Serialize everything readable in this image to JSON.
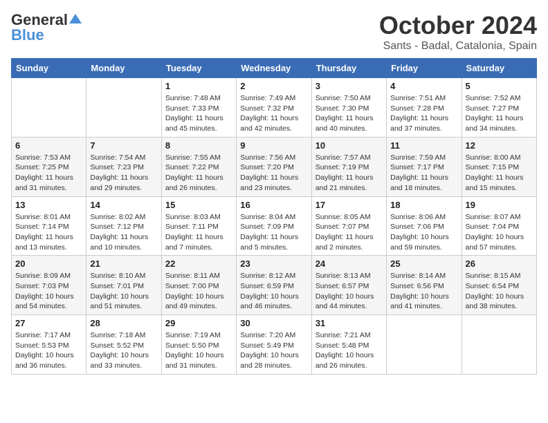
{
  "logo": {
    "general": "General",
    "blue": "Blue"
  },
  "title": "October 2024",
  "location": "Sants - Badal, Catalonia, Spain",
  "days_of_week": [
    "Sunday",
    "Monday",
    "Tuesday",
    "Wednesday",
    "Thursday",
    "Friday",
    "Saturday"
  ],
  "weeks": [
    [
      {
        "day": "",
        "sunrise": "",
        "sunset": "",
        "daylight": ""
      },
      {
        "day": "",
        "sunrise": "",
        "sunset": "",
        "daylight": ""
      },
      {
        "day": "1",
        "sunrise": "Sunrise: 7:48 AM",
        "sunset": "Sunset: 7:33 PM",
        "daylight": "Daylight: 11 hours and 45 minutes."
      },
      {
        "day": "2",
        "sunrise": "Sunrise: 7:49 AM",
        "sunset": "Sunset: 7:32 PM",
        "daylight": "Daylight: 11 hours and 42 minutes."
      },
      {
        "day": "3",
        "sunrise": "Sunrise: 7:50 AM",
        "sunset": "Sunset: 7:30 PM",
        "daylight": "Daylight: 11 hours and 40 minutes."
      },
      {
        "day": "4",
        "sunrise": "Sunrise: 7:51 AM",
        "sunset": "Sunset: 7:28 PM",
        "daylight": "Daylight: 11 hours and 37 minutes."
      },
      {
        "day": "5",
        "sunrise": "Sunrise: 7:52 AM",
        "sunset": "Sunset: 7:27 PM",
        "daylight": "Daylight: 11 hours and 34 minutes."
      }
    ],
    [
      {
        "day": "6",
        "sunrise": "Sunrise: 7:53 AM",
        "sunset": "Sunset: 7:25 PM",
        "daylight": "Daylight: 11 hours and 31 minutes."
      },
      {
        "day": "7",
        "sunrise": "Sunrise: 7:54 AM",
        "sunset": "Sunset: 7:23 PM",
        "daylight": "Daylight: 11 hours and 29 minutes."
      },
      {
        "day": "8",
        "sunrise": "Sunrise: 7:55 AM",
        "sunset": "Sunset: 7:22 PM",
        "daylight": "Daylight: 11 hours and 26 minutes."
      },
      {
        "day": "9",
        "sunrise": "Sunrise: 7:56 AM",
        "sunset": "Sunset: 7:20 PM",
        "daylight": "Daylight: 11 hours and 23 minutes."
      },
      {
        "day": "10",
        "sunrise": "Sunrise: 7:57 AM",
        "sunset": "Sunset: 7:19 PM",
        "daylight": "Daylight: 11 hours and 21 minutes."
      },
      {
        "day": "11",
        "sunrise": "Sunrise: 7:59 AM",
        "sunset": "Sunset: 7:17 PM",
        "daylight": "Daylight: 11 hours and 18 minutes."
      },
      {
        "day": "12",
        "sunrise": "Sunrise: 8:00 AM",
        "sunset": "Sunset: 7:15 PM",
        "daylight": "Daylight: 11 hours and 15 minutes."
      }
    ],
    [
      {
        "day": "13",
        "sunrise": "Sunrise: 8:01 AM",
        "sunset": "Sunset: 7:14 PM",
        "daylight": "Daylight: 11 hours and 13 minutes."
      },
      {
        "day": "14",
        "sunrise": "Sunrise: 8:02 AM",
        "sunset": "Sunset: 7:12 PM",
        "daylight": "Daylight: 11 hours and 10 minutes."
      },
      {
        "day": "15",
        "sunrise": "Sunrise: 8:03 AM",
        "sunset": "Sunset: 7:11 PM",
        "daylight": "Daylight: 11 hours and 7 minutes."
      },
      {
        "day": "16",
        "sunrise": "Sunrise: 8:04 AM",
        "sunset": "Sunset: 7:09 PM",
        "daylight": "Daylight: 11 hours and 5 minutes."
      },
      {
        "day": "17",
        "sunrise": "Sunrise: 8:05 AM",
        "sunset": "Sunset: 7:07 PM",
        "daylight": "Daylight: 11 hours and 2 minutes."
      },
      {
        "day": "18",
        "sunrise": "Sunrise: 8:06 AM",
        "sunset": "Sunset: 7:06 PM",
        "daylight": "Daylight: 10 hours and 59 minutes."
      },
      {
        "day": "19",
        "sunrise": "Sunrise: 8:07 AM",
        "sunset": "Sunset: 7:04 PM",
        "daylight": "Daylight: 10 hours and 57 minutes."
      }
    ],
    [
      {
        "day": "20",
        "sunrise": "Sunrise: 8:09 AM",
        "sunset": "Sunset: 7:03 PM",
        "daylight": "Daylight: 10 hours and 54 minutes."
      },
      {
        "day": "21",
        "sunrise": "Sunrise: 8:10 AM",
        "sunset": "Sunset: 7:01 PM",
        "daylight": "Daylight: 10 hours and 51 minutes."
      },
      {
        "day": "22",
        "sunrise": "Sunrise: 8:11 AM",
        "sunset": "Sunset: 7:00 PM",
        "daylight": "Daylight: 10 hours and 49 minutes."
      },
      {
        "day": "23",
        "sunrise": "Sunrise: 8:12 AM",
        "sunset": "Sunset: 6:59 PM",
        "daylight": "Daylight: 10 hours and 46 minutes."
      },
      {
        "day": "24",
        "sunrise": "Sunrise: 8:13 AM",
        "sunset": "Sunset: 6:57 PM",
        "daylight": "Daylight: 10 hours and 44 minutes."
      },
      {
        "day": "25",
        "sunrise": "Sunrise: 8:14 AM",
        "sunset": "Sunset: 6:56 PM",
        "daylight": "Daylight: 10 hours and 41 minutes."
      },
      {
        "day": "26",
        "sunrise": "Sunrise: 8:15 AM",
        "sunset": "Sunset: 6:54 PM",
        "daylight": "Daylight: 10 hours and 38 minutes."
      }
    ],
    [
      {
        "day": "27",
        "sunrise": "Sunrise: 7:17 AM",
        "sunset": "Sunset: 5:53 PM",
        "daylight": "Daylight: 10 hours and 36 minutes."
      },
      {
        "day": "28",
        "sunrise": "Sunrise: 7:18 AM",
        "sunset": "Sunset: 5:52 PM",
        "daylight": "Daylight: 10 hours and 33 minutes."
      },
      {
        "day": "29",
        "sunrise": "Sunrise: 7:19 AM",
        "sunset": "Sunset: 5:50 PM",
        "daylight": "Daylight: 10 hours and 31 minutes."
      },
      {
        "day": "30",
        "sunrise": "Sunrise: 7:20 AM",
        "sunset": "Sunset: 5:49 PM",
        "daylight": "Daylight: 10 hours and 28 minutes."
      },
      {
        "day": "31",
        "sunrise": "Sunrise: 7:21 AM",
        "sunset": "Sunset: 5:48 PM",
        "daylight": "Daylight: 10 hours and 26 minutes."
      },
      {
        "day": "",
        "sunrise": "",
        "sunset": "",
        "daylight": ""
      },
      {
        "day": "",
        "sunrise": "",
        "sunset": "",
        "daylight": ""
      }
    ]
  ]
}
